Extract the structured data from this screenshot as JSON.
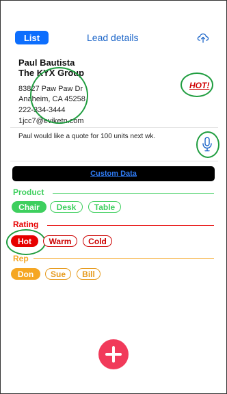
{
  "header": {
    "list_button": "List",
    "title": "Lead details"
  },
  "contact": {
    "name": "Paul Bautista",
    "company": "The KYX Group",
    "address_line1": "83827 Paw Paw Dr",
    "address_line2": "Anaheim, CA 45258",
    "phone": "222-334-3444",
    "email": "1jcc7@eviketn.com",
    "hot_tag": "HOT!"
  },
  "note": "Paul would like a quote for 100 units next wk.",
  "custom_data": {
    "label": "Custom Data"
  },
  "sections": {
    "product": {
      "label": "Product",
      "options": [
        "Chair",
        "Desk",
        "Table"
      ],
      "selected": "Chair"
    },
    "rating": {
      "label": "Rating",
      "options": [
        "Hot",
        "Warm",
        "Cold"
      ],
      "selected": "Hot"
    },
    "rep": {
      "label": "Rep",
      "options": [
        "Don",
        "Sue",
        "Bill"
      ],
      "selected": "Don"
    }
  },
  "colors": {
    "accent_blue": "#0d6efd",
    "product_green": "#3ecf5e",
    "rating_red": "#e60000",
    "rep_orange": "#f5a623",
    "fab_pink": "#f13a5a",
    "annotation_green": "#1f9d3f"
  },
  "icons": {
    "upload": "cloud-upload-icon",
    "mic": "microphone-icon",
    "add": "plus-icon"
  }
}
